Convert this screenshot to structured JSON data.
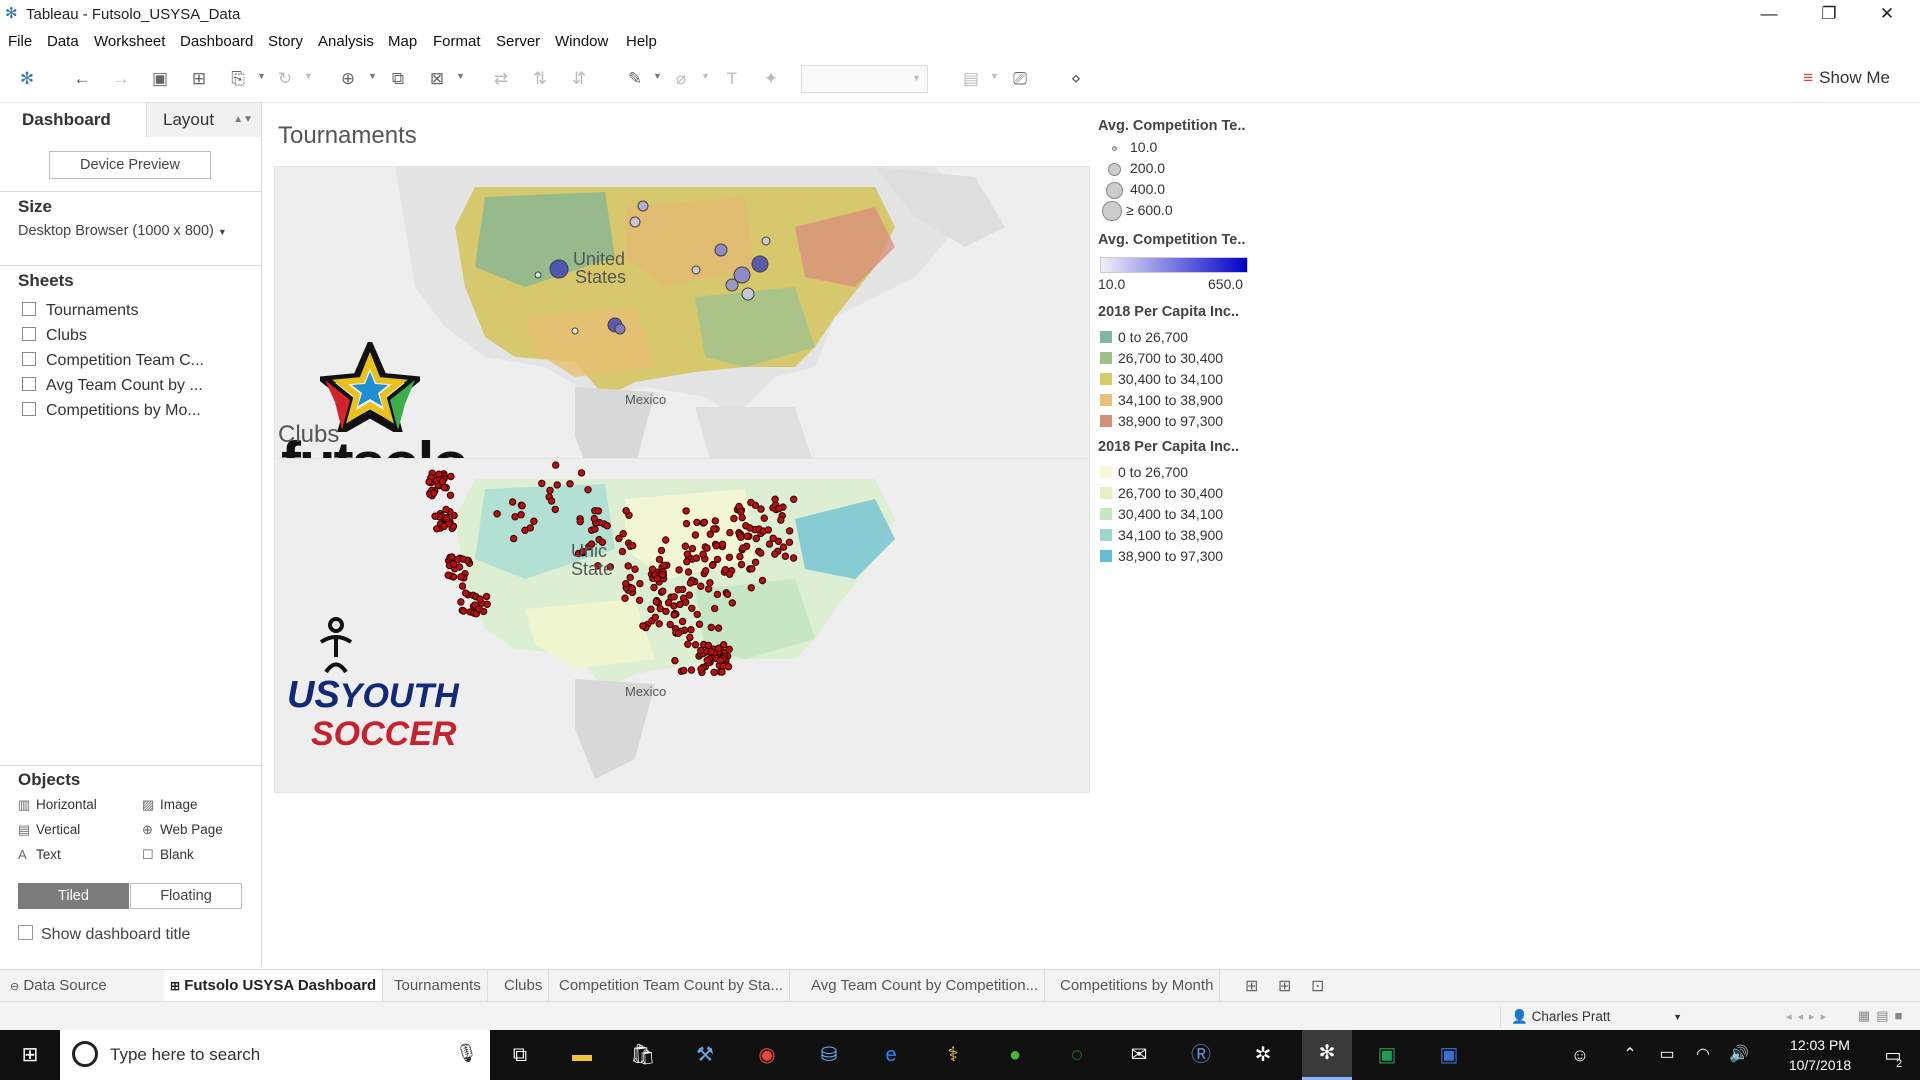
{
  "window": {
    "title": "Tableau - Futsolo_USYSA_Data",
    "controls": [
      "—",
      "❐",
      "✕"
    ]
  },
  "menu": [
    "File",
    "Data",
    "Worksheet",
    "Dashboard",
    "Story",
    "Analysis",
    "Map",
    "Format",
    "Server",
    "Window",
    "Help"
  ],
  "toolbar": {
    "show_me": "Show Me"
  },
  "left": {
    "tab_dashboard": "Dashboard",
    "tab_layout": "Layout",
    "device_preview": "Device Preview",
    "size_heading": "Size",
    "size_value": "Desktop Browser (1000 x 800)",
    "sheets_heading": "Sheets",
    "sheets": [
      "Tournaments",
      "Clubs",
      "Competition Team C...",
      "Avg Team Count by ...",
      "Competitions by Mo..."
    ],
    "objects_heading": "Objects",
    "objects": {
      "horizontal": "Horizontal",
      "image": "Image",
      "vertical": "Vertical",
      "web_page": "Web Page",
      "text": "Text",
      "blank": "Blank"
    },
    "tiled": "Tiled",
    "floating": "Floating",
    "show_title": "Show dashboard title"
  },
  "dashboard": {
    "tournaments_title": "Tournaments",
    "clubs_title": "Clubs",
    "map_label_us_1": "United",
    "map_label_us_2": "States",
    "map_label_us_b1": "Unic",
    "map_label_us_b2": "State",
    "map_label_mexico": "Mexico",
    "logo_futsolo": "futsolo",
    "logo_us": "US",
    "logo_youth": "YOUTH",
    "logo_soccer": "SOCCER",
    "legend_size_title": "Avg. Competition Te..",
    "legend_size_items": [
      "10.0",
      "200.0",
      "400.0",
      "≥ 600.0"
    ],
    "legend_color_title": "Avg. Competition Te..",
    "legend_color_min": "10.0",
    "legend_color_max": "650.0",
    "legend_inc1_title": "2018 Per Capita Inc..",
    "legend_inc1_items": [
      "0 to 26,700",
      "26,700 to 30,400",
      "30,400 to 34,100",
      "34,100 to 38,900",
      "38,900 to 97,300"
    ],
    "legend_inc1_colors": [
      "#7fb6a5",
      "#9fbf8a",
      "#d4cc6a",
      "#e8bf74",
      "#d98e7a"
    ],
    "legend_inc2_title": "2018 Per Capita Inc..",
    "legend_inc2_items": [
      "0 to 26,700",
      "26,700 to 30,400",
      "30,400 to 34,100",
      "34,100 to 38,900",
      "38,900 to 97,300"
    ],
    "legend_inc2_colors": [
      "#f5f7d8",
      "#e6f0c6",
      "#c9e6c5",
      "#9fd6cf",
      "#64bdd1"
    ]
  },
  "tabs": [
    "Data Source",
    "Futsolo USYSA Dashboard",
    "Tournaments",
    "Clubs",
    "Competition Team Count by Sta...",
    "Avg Team Count by Competition...",
    "Competitions by Month"
  ],
  "status": {
    "user": "Charles Pratt"
  },
  "taskbar": {
    "search_placeholder": "Type here to search",
    "time": "12:03 PM",
    "date": "10/7/2018",
    "notif_count": "2"
  }
}
